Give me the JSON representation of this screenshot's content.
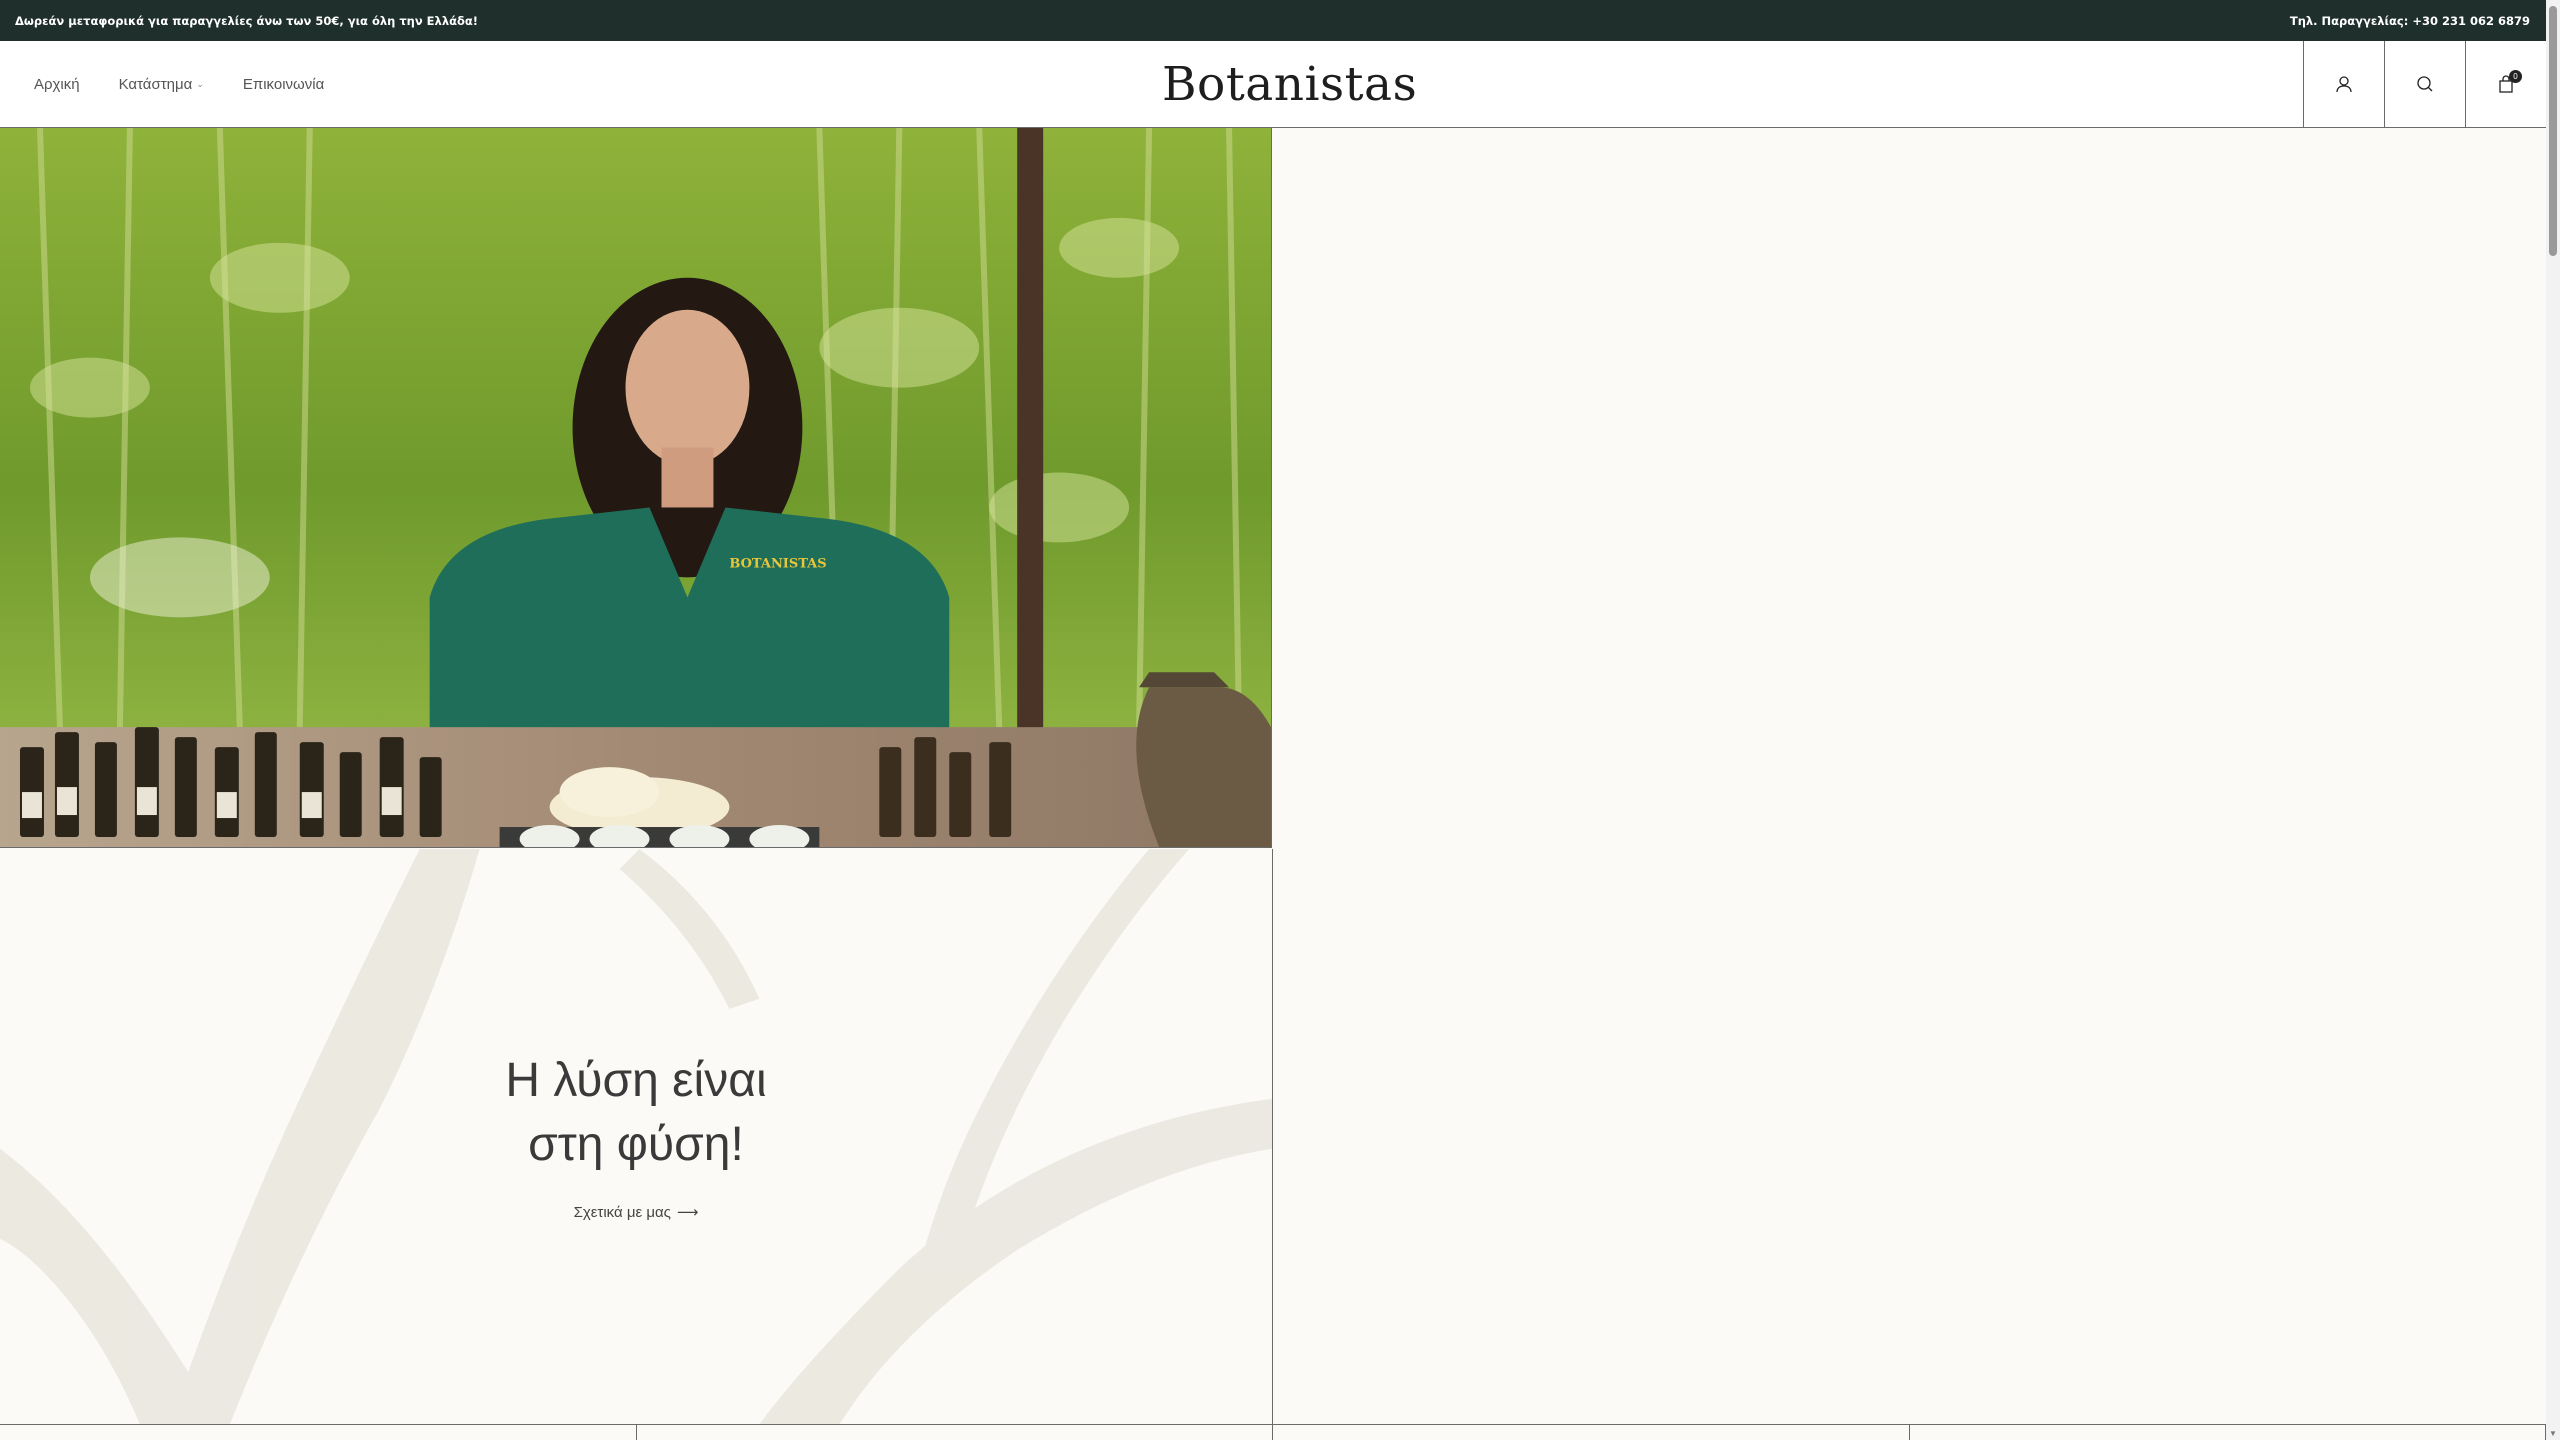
{
  "announcement": {
    "left": "Δωρεάν μεταφορικά για παραγγελίες άνω των 50€, για όλη την Ελλάδα!",
    "right": "Τηλ. Παραγγελίας: +30 231 062 6879"
  },
  "header": {
    "nav": [
      {
        "label": "Αρχική"
      },
      {
        "label": "Κατάστημα"
      },
      {
        "label": "Επικοινωνία"
      }
    ],
    "logo": "Botanistas",
    "cart_count": "0"
  },
  "hero": {
    "uniform_text": "BOTANISTAS",
    "headline_line1": "Η λύση είναι",
    "headline_line2": "στη φύση!",
    "about_link": "Σχετικά με μας",
    "arrow": "⟶"
  },
  "colors": {
    "topbar_bg": "#1f2f2b",
    "page_bg": "#fbfaf6",
    "uniform": "#1f6e5a"
  }
}
